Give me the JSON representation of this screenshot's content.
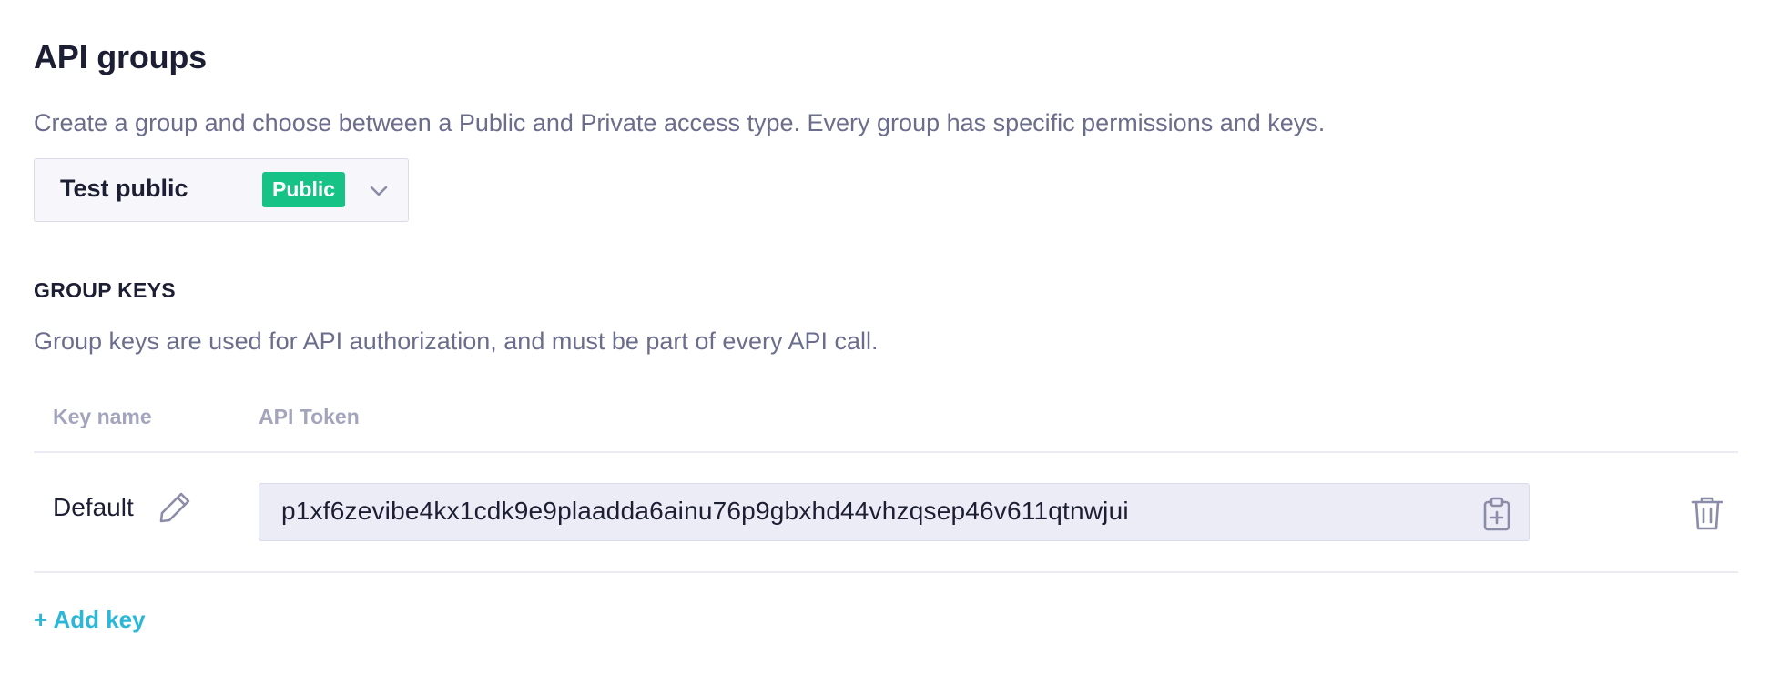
{
  "header": {
    "title": "API groups",
    "description": "Create a group and choose between a Public and Private access type. Every group has specific permissions and keys."
  },
  "group_select": {
    "selected_group": "Test public",
    "access_badge": "Public",
    "badge_color": "#17c286",
    "icon": "chevron-down-icon"
  },
  "group_keys": {
    "heading": "GROUP KEYS",
    "description": "Group keys are used for API authorization, and must be part of every API call.",
    "columns": [
      "Key name",
      "API Token"
    ],
    "rows": [
      {
        "key_name": "Default",
        "api_token": "p1xf6zevibe4kx1cdk9e9plaadda6ainu76p9gbxhd44vhzqsep46v611qtnwjui",
        "icons": [
          "pencil-icon",
          "clipboard-icon",
          "trash-icon"
        ]
      }
    ],
    "add_key_label": "+ Add key",
    "link_color": "#2cb6d8"
  }
}
